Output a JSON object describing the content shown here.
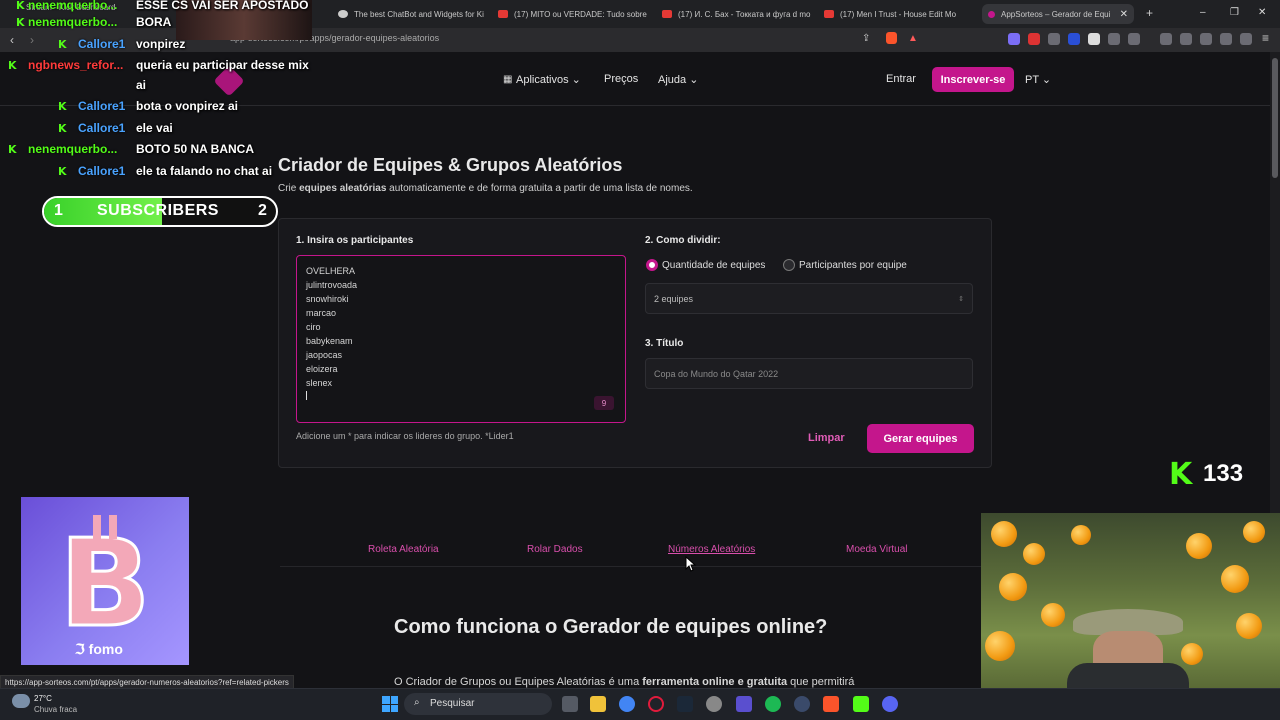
{
  "browser": {
    "tabs": [
      {
        "label": "Stream - Kick Dashboard"
      },
      {
        "label": "The best ChatBot and Widgets for Ki"
      },
      {
        "label": "(17) MITO ou VERDADE: Tudo sobre"
      },
      {
        "label": "(17) И. С. Бах - Токката и фуга d mo"
      },
      {
        "label": "(17) Men I Trust - House Edit Mo"
      },
      {
        "label": "AppSorteos – Gerador de Equip"
      }
    ],
    "url": "app-sorteos.com/pt/apps/gerador-equipes-aleatorios",
    "status_url": "https://app-sorteos.com/pt/apps/gerador-numeros-aleatorios?ref=related-pickers"
  },
  "site": {
    "nav": {
      "apps": "Aplicativos",
      "prices": "Preços",
      "help": "Ajuda",
      "login": "Entrar",
      "signup": "Inscrever-se",
      "lang": "PT"
    },
    "title": "Criador de Equipes & Grupos Aleatórios",
    "subtitle_pre": "Crie ",
    "subtitle_bold": "equipes aleatórias",
    "subtitle_post": " automaticamente e de forma gratuita a partir de uma lista de nomes.",
    "step1": "1. Insira os participantes",
    "participants": [
      "OVELHERA",
      "julintrovoada",
      "snowhiroki",
      "marcao",
      "ciro",
      "babykenam",
      "jaopocas",
      "eloizera",
      "slenex"
    ],
    "count": "9",
    "hint": "Adicione um * para indicar os lideres do grupo. *Lider1",
    "step2": "2. Como dividir:",
    "radio_teams": "Quantidade de equipes",
    "radio_per_team": "Participantes por equipe",
    "teams_select": "2 equipes",
    "step3": "3. Título",
    "title_placeholder": "Copa do Mundo do Qatar 2022",
    "clear": "Limpar",
    "generate": "Gerar equipes",
    "related": [
      "Roleta Aleatória",
      "Rolar Dados",
      "Números Aleatórios",
      "Moeda Virtual"
    ],
    "how_title": "Como funciona o Gerador de equipes online?",
    "how_pre": "O Criador de Grupos ou Equipes Aleatórias é uma ",
    "how_bold": "ferramenta online e gratuita",
    "how_post": " que permitirá"
  },
  "overlay": {
    "chat": [
      {
        "user": "nenemquerbo...",
        "msg": "ESSE CS VAI SER APOSTADO",
        "color": "#53fc18"
      },
      {
        "user": "nenemquerbo...",
        "msg": "BORA",
        "color": "#53fc18"
      },
      {
        "user": "Callore1",
        "msg": "vonpirez",
        "color": "#4aa3ff"
      },
      {
        "user": "ngbnews_refor...",
        "msg": "queria eu participar desse mix",
        "color": "#ff3b3b"
      },
      {
        "user": "",
        "msg": "ai",
        "color": "#ffffff"
      },
      {
        "user": "Callore1",
        "msg": "bota o vonpirez ai",
        "color": "#4aa3ff"
      },
      {
        "user": "Callore1",
        "msg": "ele vai",
        "color": "#4aa3ff"
      },
      {
        "user": "nenemquerbo...",
        "msg": "BOTO 50 NA BANCA",
        "color": "#53fc18"
      },
      {
        "user": "Callore1",
        "msg": "ele ta falando no chat ai",
        "color": "#4aa3ff"
      }
    ],
    "subs_left": "1",
    "subs_label": "SUBSCRIBERS",
    "subs_right": "2",
    "viewers": "133",
    "ad_brand": "fomo"
  },
  "taskbar": {
    "temp": "27°C",
    "weather": "Chuva fraca",
    "search": "Pesquisar"
  }
}
